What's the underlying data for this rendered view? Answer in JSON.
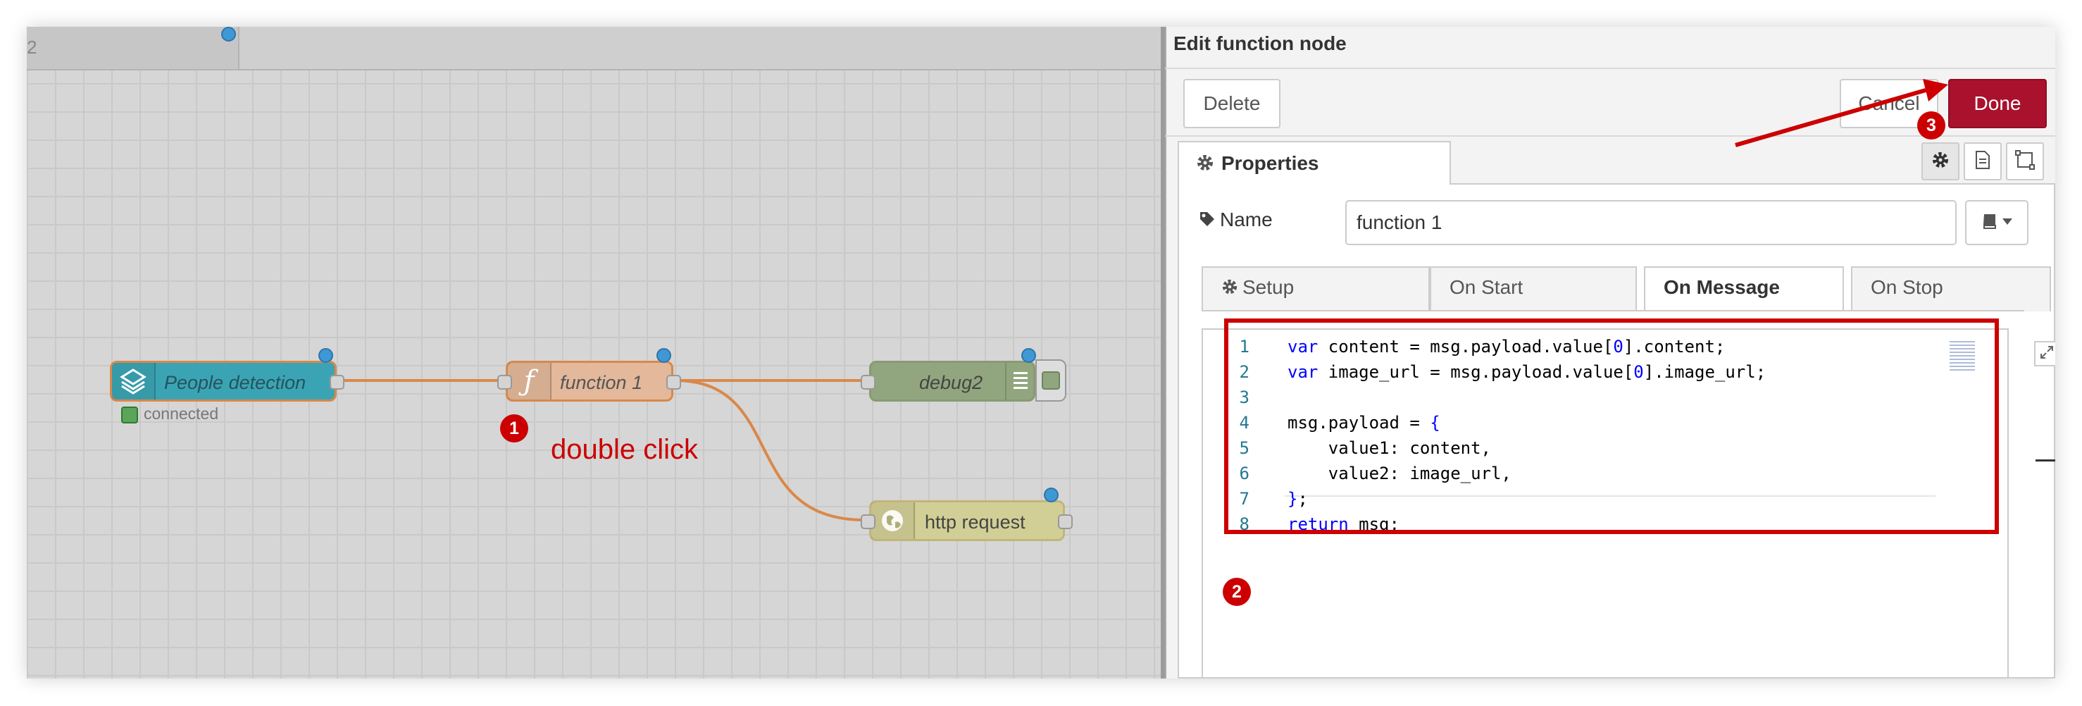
{
  "workspace": {
    "tab_label": "2",
    "nodes": {
      "people_detection": {
        "label": "People detection",
        "status": "connected"
      },
      "function1": {
        "label": "function 1"
      },
      "debug2": {
        "label": "debug2"
      },
      "http_request": {
        "label": "http request"
      }
    },
    "annotation": {
      "step1": "1",
      "step1_text": "double click",
      "step2": "2",
      "step3": "3"
    }
  },
  "editor": {
    "title": "Edit function node",
    "buttons": {
      "delete": "Delete",
      "cancel": "Cancel",
      "done": "Done"
    },
    "properties_tab": "Properties",
    "name_label": "Name",
    "name_value": "function 1",
    "subtabs": [
      "Setup",
      "On Start",
      "On Message",
      "On Stop"
    ],
    "active_subtab": "On Message",
    "code_lines": [
      "var content = msg.payload.value[0].content;",
      "var image_url = msg.payload.value[0].image_url;",
      "",
      "msg.payload = {",
      "    value1: content,",
      "    value2: image_url,",
      "};",
      "return msg;"
    ]
  },
  "colors": {
    "done_button": "#a9112c",
    "annotation_red": "#cc0000",
    "people_detection_node": "#3ba4b4",
    "function_node": "#e3b89b",
    "debug_node": "#91a67e",
    "http_request_node": "#d2cf96",
    "wire": "#d9884a"
  },
  "icons": [
    "gear-icon",
    "tag-icon",
    "book-icon",
    "document-icon",
    "frame-icon",
    "expand-icon",
    "function-icon",
    "globe-icon",
    "list-icon",
    "layers-icon",
    "caret-down-icon"
  ]
}
